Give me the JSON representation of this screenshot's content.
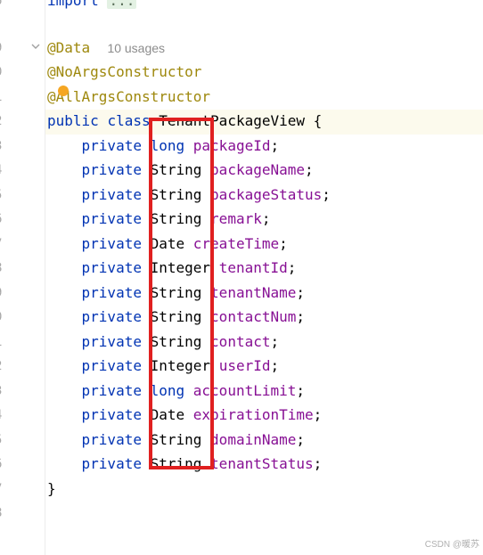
{
  "gutter": {
    "line_numbers": [
      "6",
      "",
      "",
      "9",
      "0",
      "1",
      "2",
      "3",
      "4",
      "5",
      "6",
      "7",
      "8",
      "9",
      "0",
      "1",
      "2",
      "3",
      "4",
      "5",
      "6",
      "7",
      "8"
    ]
  },
  "code": {
    "import_kw": "import",
    "import_fold": "...",
    "data_ann": "@Data",
    "usages": "10 usages",
    "noargs_ann": "@NoArgsConstructor",
    "allargs_ann": "@AllArgsConstructor",
    "class_public": "public",
    "class_kw": "class",
    "class_name": "TenantPackageView",
    "class_open": "{",
    "modifier": "private",
    "fields": [
      {
        "type": "long",
        "name": "packageId"
      },
      {
        "type": "String",
        "name": "packageName"
      },
      {
        "type": "String",
        "name": "packageStatus"
      },
      {
        "type": "String",
        "name": "remark"
      },
      {
        "type": "Date",
        "name": "createTime"
      },
      {
        "type": "Integer",
        "name": "tenantId"
      },
      {
        "type": "String",
        "name": "tenantName"
      },
      {
        "type": "String",
        "name": "contactNum"
      },
      {
        "type": "String",
        "name": "contact"
      },
      {
        "type": "Integer",
        "name": "userId"
      },
      {
        "type": "long",
        "name": "accountLimit"
      },
      {
        "type": "Date",
        "name": "expirationTime"
      },
      {
        "type": "String",
        "name": "domainName"
      },
      {
        "type": "String",
        "name": "tenantStatus"
      }
    ],
    "semicolon": ";",
    "class_close": "}"
  },
  "watermark": "CSDN @暖苏",
  "colors": {
    "keyword": "#0033b3",
    "annotation": "#9e880d",
    "field": "#871094",
    "highlight_box": "#e02020"
  }
}
